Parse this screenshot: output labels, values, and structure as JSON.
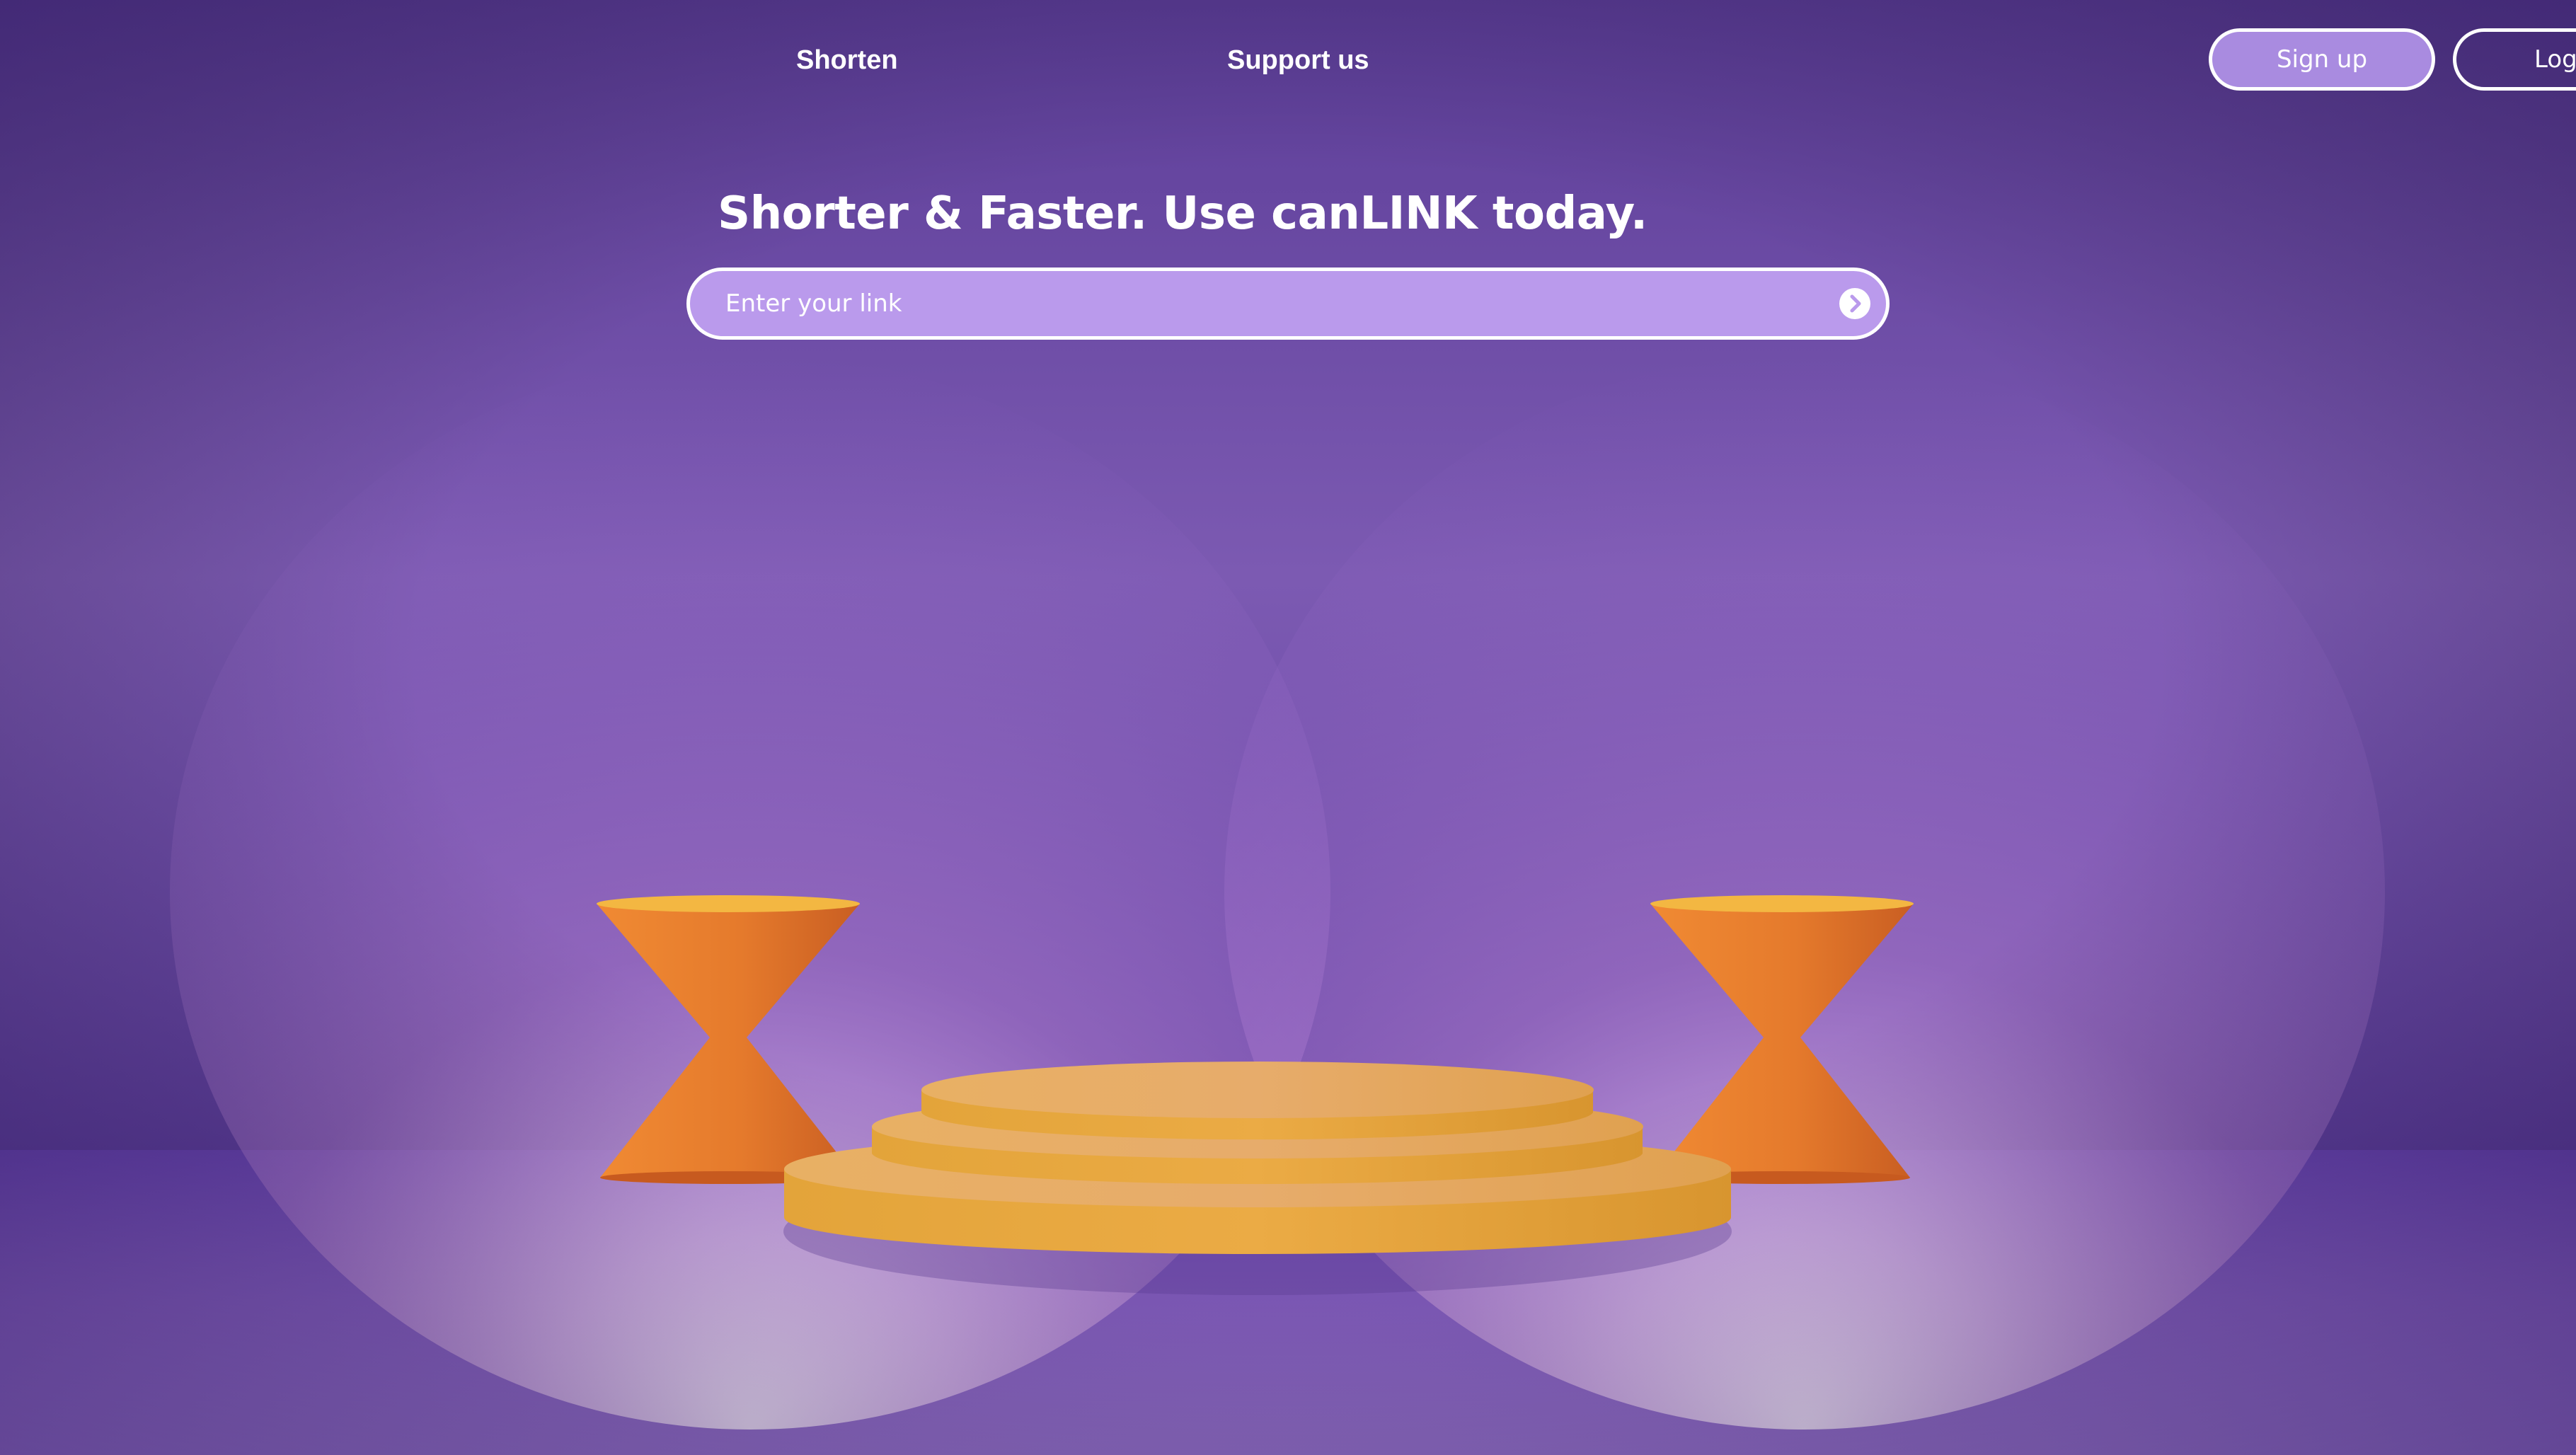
{
  "nav": {
    "shorten_label": "Shorten",
    "support_label": "Support us"
  },
  "auth": {
    "signup_label": "Sign up",
    "login_label": "Log"
  },
  "hero": {
    "headline": "Shorter & Faster. Use canLINK today.",
    "input_placeholder": "Enter your link",
    "input_value": "",
    "submit_icon": "arrow-right-circle-icon"
  },
  "colors": {
    "background": "#6a4aa6",
    "input_fill": "#ba9aec",
    "signup_fill": "#a98be0",
    "podium": "#e4a43e",
    "pedestals": "#e0772c"
  }
}
